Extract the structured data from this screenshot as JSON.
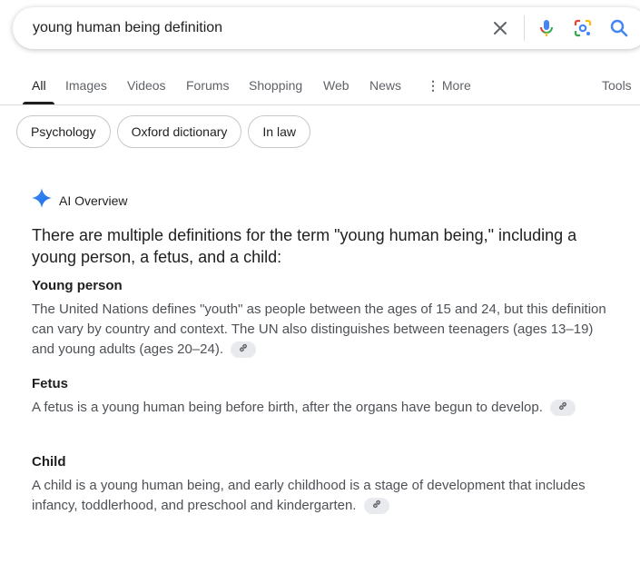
{
  "search": {
    "query": "young human being definition"
  },
  "tabs": [
    {
      "label": "All"
    },
    {
      "label": "Images"
    },
    {
      "label": "Videos"
    },
    {
      "label": "Forums"
    },
    {
      "label": "Shopping"
    },
    {
      "label": "Web"
    },
    {
      "label": "News"
    },
    {
      "label": "More"
    },
    {
      "label": "Tools"
    }
  ],
  "chips": [
    {
      "label": "Psychology"
    },
    {
      "label": "Oxford dictionary"
    },
    {
      "label": "In law"
    }
  ],
  "ai_overview": {
    "label": "AI Overview",
    "lead": "There are multiple definitions for the term \"young human being,\" including a young person, a fetus, and a child:",
    "sections": [
      {
        "title": "Young person",
        "body": "The United Nations defines \"youth\" as people between the ages of 15 and 24, but this definition can vary by country and context. The UN also distinguishes between teenagers (ages 13–19) and young adults (ages 20–24)."
      },
      {
        "title": "Fetus",
        "body": "A fetus is a young human being before birth, after the organs have begun to develop."
      },
      {
        "title": "Child",
        "body": "A child is a young human being, and early childhood is a stage of development that includes infancy, toddlerhood, and preschool and kindergarten."
      }
    ]
  },
  "colors": {
    "accent_blue": "#4285f4",
    "mic_red": "#ea4335",
    "text_secondary": "#4d5156"
  }
}
